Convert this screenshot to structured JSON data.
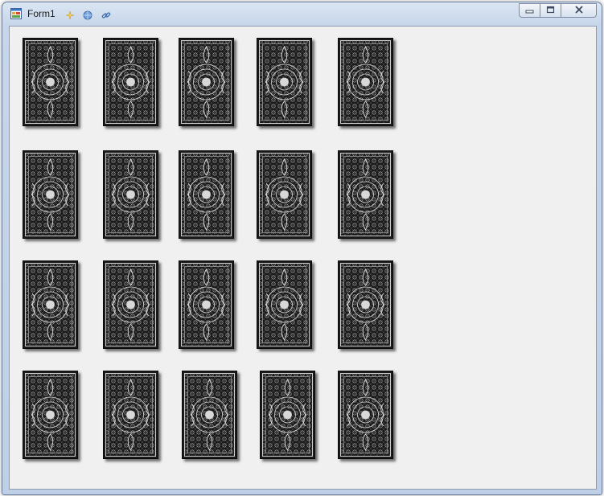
{
  "window": {
    "title": "Form1",
    "icons": {
      "app": "form-app-icon",
      "quick_access": [
        "sparkle-icon",
        "globe-icon",
        "link-icon"
      ],
      "caption": [
        "minimize-icon",
        "maximize-icon",
        "close-icon"
      ]
    }
  },
  "cards": {
    "rows": 4,
    "columns": 5,
    "face": "card-back",
    "items": [
      {
        "row": 1,
        "col": 1
      },
      {
        "row": 1,
        "col": 2
      },
      {
        "row": 1,
        "col": 3
      },
      {
        "row": 1,
        "col": 4
      },
      {
        "row": 1,
        "col": 5
      },
      {
        "row": 2,
        "col": 1
      },
      {
        "row": 2,
        "col": 2
      },
      {
        "row": 2,
        "col": 3
      },
      {
        "row": 2,
        "col": 4
      },
      {
        "row": 2,
        "col": 5
      },
      {
        "row": 3,
        "col": 1
      },
      {
        "row": 3,
        "col": 2
      },
      {
        "row": 3,
        "col": 3
      },
      {
        "row": 3,
        "col": 4
      },
      {
        "row": 3,
        "col": 5
      },
      {
        "row": 4,
        "col": 1
      },
      {
        "row": 4,
        "col": 2
      },
      {
        "row": 4,
        "col": 3
      },
      {
        "row": 4,
        "col": 4
      },
      {
        "row": 4,
        "col": 5
      }
    ]
  },
  "colors": {
    "client_background": "#f0f0f0",
    "card_background": "#1b1b1b",
    "card_pattern": "#d8d8d8"
  }
}
